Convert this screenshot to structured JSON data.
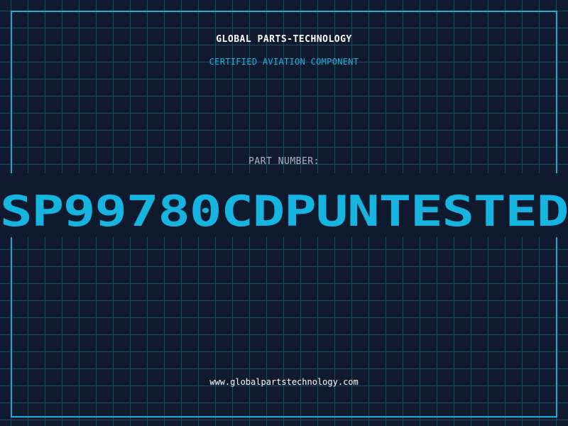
{
  "label": {
    "company": "GLOBAL PARTS-TECHNOLOGY",
    "subtitle": "CERTIFIED AVIATION COMPONENT",
    "part_number_label": "PART NUMBER:",
    "part_number": "SP99780CDPUNTESTED",
    "website": "www.globalpartstechnology.com"
  },
  "colors": {
    "background": "#0f1a2e",
    "grid": "#1c4a63",
    "accent": "#16b4e0",
    "text_primary": "#ffffff",
    "text_muted": "#a9b4c2"
  }
}
